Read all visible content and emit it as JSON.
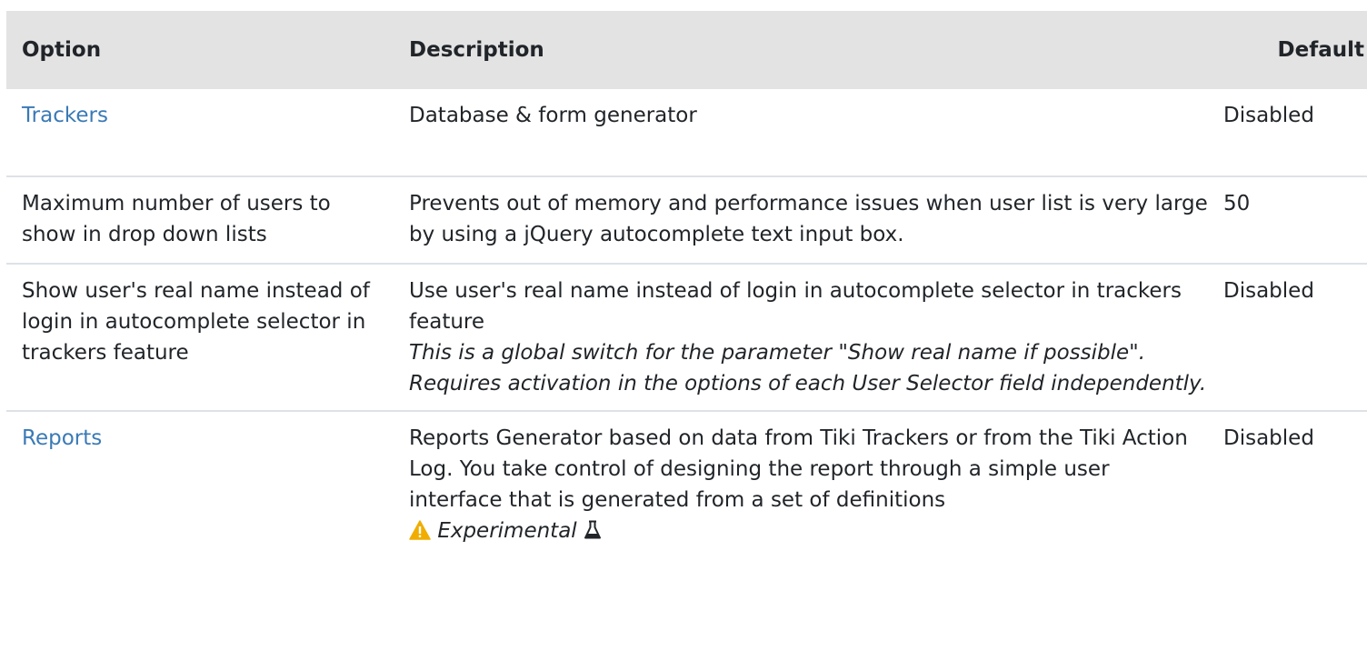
{
  "columns": {
    "option": "Option",
    "description": "Description",
    "default": "Default"
  },
  "rows": [
    {
      "option": "Trackers",
      "option_is_link": true,
      "description": "Database & form generator",
      "default": "Disabled"
    },
    {
      "option": "Maximum number of users to show in drop down lists",
      "option_is_link": false,
      "description": "Prevents out of memory and performance issues when user list is very large by using a jQuery autocomplete text input box.",
      "default": "50"
    },
    {
      "option": "Show user's real name instead of login in autocomplete selector in trackers feature",
      "option_is_link": false,
      "description": "Use user's real name instead of login in autocomplete selector in trackers feature",
      "note": "This is a global switch for the parameter \"Show real name if possible\". Requires activation in the options of each User Selector field independently.",
      "default": "Disabled"
    },
    {
      "option": "Reports",
      "option_is_link": true,
      "description": "Reports Generator based on data from Tiki Trackers or from the Tiki Action Log. You take control of designing the report through a simple user interface that is generated from a set of definitions",
      "badge": "Experimental",
      "default": "Disabled"
    }
  ],
  "icons": {
    "warning": "warning-icon",
    "flask": "flask-icon"
  },
  "colors": {
    "header_bg": "#e3e3e3",
    "link": "#3a7ab6",
    "warning": "#f0ad00",
    "row_border": "#dee2e6"
  }
}
